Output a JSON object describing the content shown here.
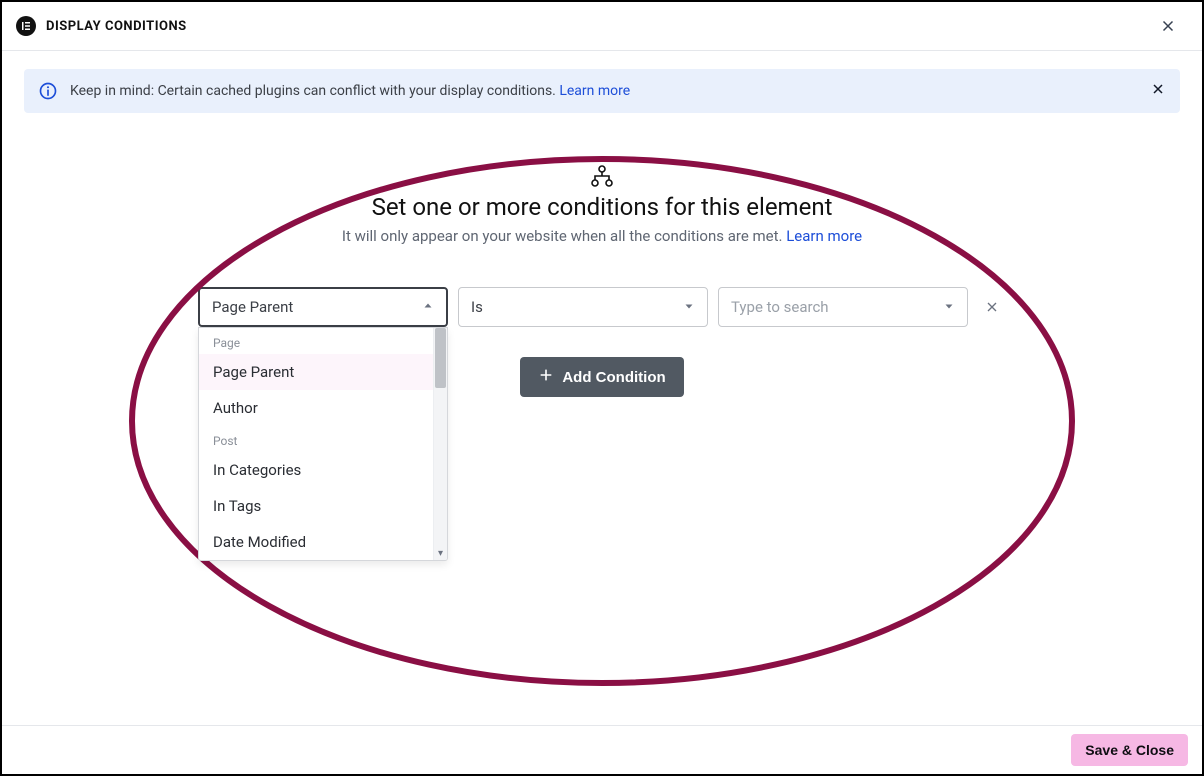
{
  "header": {
    "title": "DISPLAY CONDITIONS"
  },
  "alert": {
    "text": "Keep in mind: Certain cached plugins can conflict with your display conditions. ",
    "link": "Learn more"
  },
  "main": {
    "title": "Set one or more conditions for this element",
    "subtitle_text": "It will only appear on your website when all the conditions are met. ",
    "subtitle_link": "Learn more"
  },
  "condition_row": {
    "condition_selected": "Page Parent",
    "operator_selected": "Is",
    "search_placeholder": "Type to search"
  },
  "dropdown": {
    "groups": [
      {
        "label": "Page",
        "items": [
          "Page Parent",
          "Author"
        ]
      },
      {
        "label": "Post",
        "items": [
          "In Categories",
          "In Tags",
          "Date Modified"
        ]
      }
    ],
    "selected": "Page Parent"
  },
  "buttons": {
    "add_condition": "Add Condition",
    "save_close": "Save & Close"
  }
}
